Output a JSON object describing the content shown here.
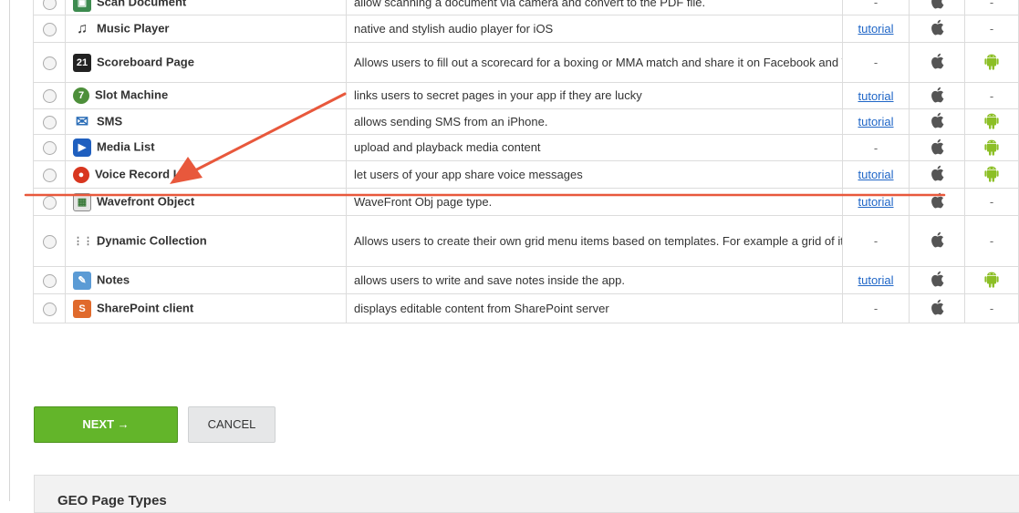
{
  "page_types": {
    "rows": [
      {
        "name": "Scan Document",
        "icon": "scan-document-icon",
        "description": "allow scanning a document via camera and convert to the PDF file.",
        "tutorial": "-",
        "ios": true,
        "android": "-"
      },
      {
        "name": "Music Player",
        "icon": "music-note-icon",
        "description": "native and stylish audio player for iOS",
        "tutorial": "tutorial",
        "ios": true,
        "android": "-"
      },
      {
        "name": "Scoreboard Page",
        "icon": "scoreboard-21-icon",
        "description": "Allows users to fill out a scorecard for a boxing or MMA match and share it on Facebook and Twitter.",
        "tutorial": "-",
        "ios": true,
        "android": "android"
      },
      {
        "name": "Slot Machine",
        "icon": "slot-machine-7-icon",
        "description": "links users to secret pages in your app if they are lucky",
        "tutorial": "tutorial",
        "ios": true,
        "android": "-"
      },
      {
        "name": "SMS",
        "icon": "envelope-icon",
        "description": "allows sending SMS from an iPhone.",
        "tutorial": "tutorial",
        "ios": true,
        "android": "android"
      },
      {
        "name": "Media List",
        "icon": "media-list-icon",
        "description": "upload and playback media content",
        "tutorial": "-",
        "ios": true,
        "android": "android"
      },
      {
        "name": "Voice Record List",
        "icon": "microphone-icon",
        "description": "let users of your app share voice messages",
        "tutorial": "tutorial",
        "ios": true,
        "android": "android"
      },
      {
        "name": "Wavefront Object",
        "icon": "wavefront-object-icon",
        "description": "WaveFront Obj page type.",
        "tutorial": "tutorial",
        "ios": true,
        "android": "-"
      },
      {
        "name": "Dynamic Collection",
        "icon": "grid-dots-icon",
        "description": "Allows users to create their own grid menu items based on templates. For example a grid of items with images and text which open other app pages when activated.",
        "tutorial": "-",
        "ios": true,
        "android": "-"
      },
      {
        "name": "Notes",
        "icon": "notes-pencil-icon",
        "description": "allows users to write and save notes inside the app.",
        "tutorial": "tutorial",
        "ios": true,
        "android": "android"
      },
      {
        "name": "SharePoint client",
        "icon": "sharepoint-icon",
        "description": "displays editable content from SharePoint server",
        "tutorial": "-",
        "ios": true,
        "android": "-"
      }
    ]
  },
  "buttons": {
    "next_label": "NEXT →",
    "cancel_label": "CANCEL"
  },
  "geo_section": {
    "title": "GEO Page Types"
  },
  "colors": {
    "next_button": "#63b52a",
    "annotation_red": "#e8583c",
    "android_green": "#8cbf26",
    "link_blue": "#1f66c7"
  }
}
